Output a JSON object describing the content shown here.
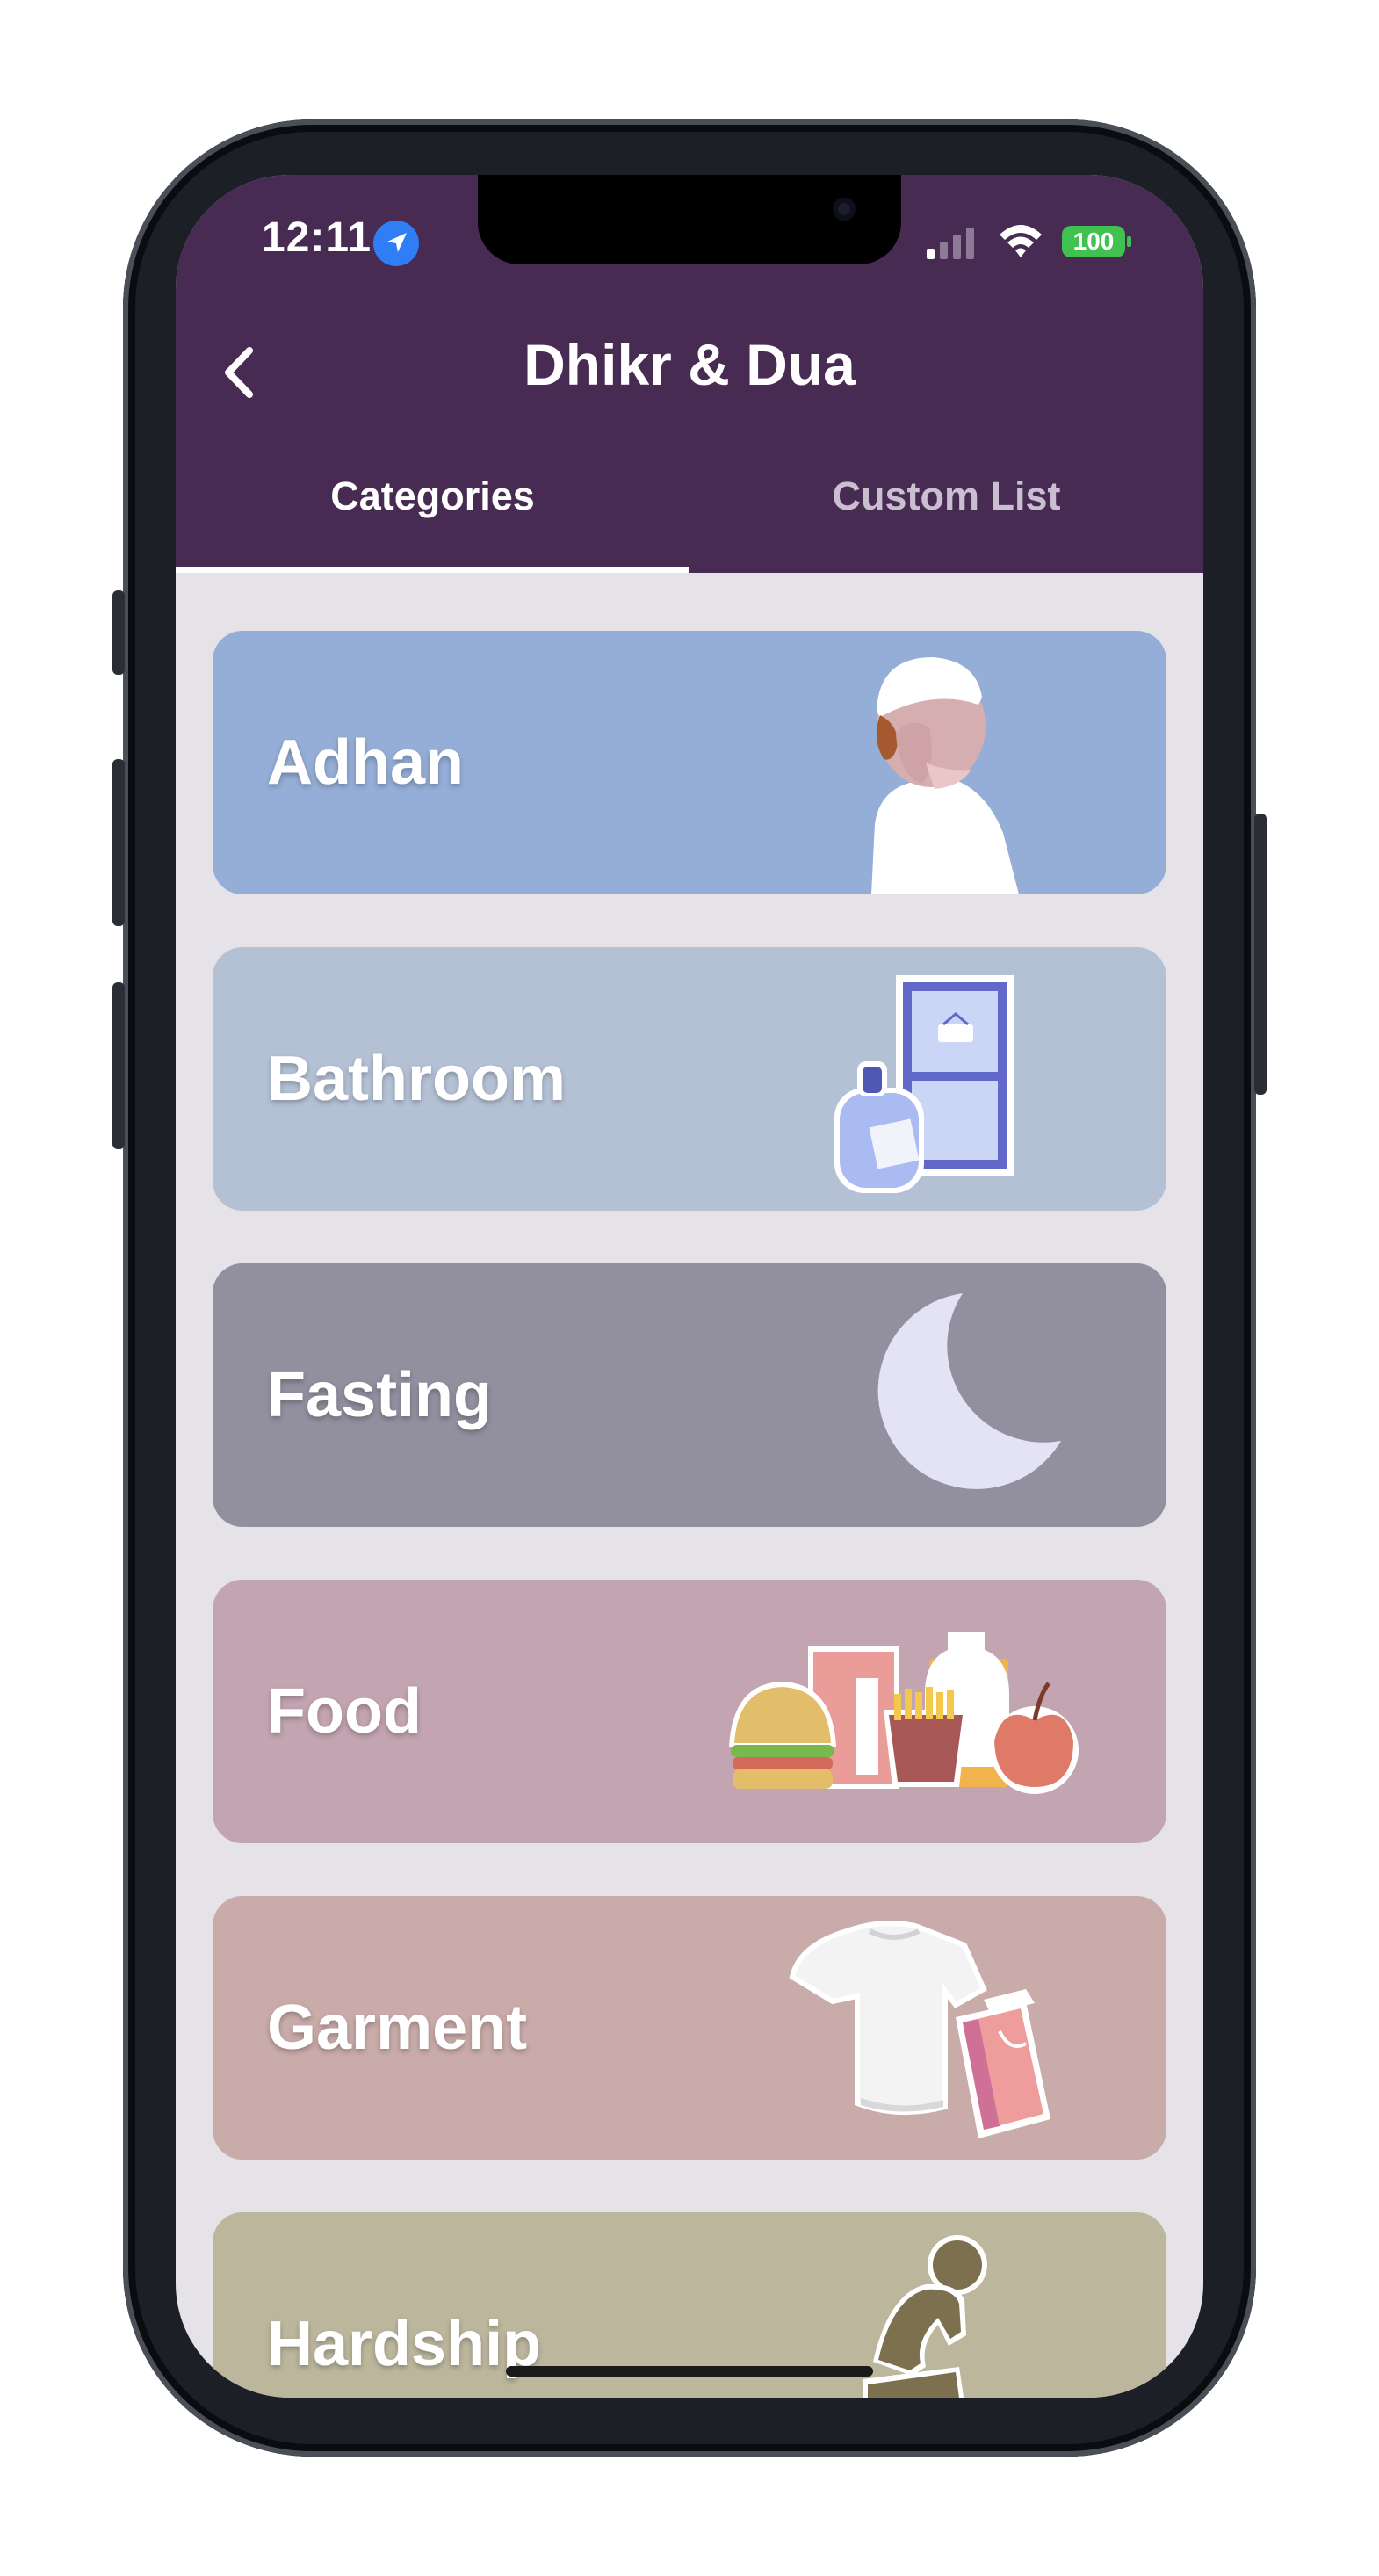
{
  "status_bar": {
    "time": "12:11",
    "battery": "100"
  },
  "header": {
    "title": "Dhikr & Dua"
  },
  "tabs": [
    {
      "label": "Categories",
      "selected": true
    },
    {
      "label": "Custom List",
      "selected": false
    }
  ],
  "categories": [
    {
      "label": "Adhan",
      "color": "#95aed7",
      "icon": "praying-man-icon"
    },
    {
      "label": "Bathroom",
      "color": "#b4c1d5",
      "icon": "door-soap-icon"
    },
    {
      "label": "Fasting",
      "color": "#928f9f",
      "icon": "crescent-moon-icon"
    },
    {
      "label": "Food",
      "color": "#c3a4b1",
      "icon": "food-icon"
    },
    {
      "label": "Garment",
      "color": "#c9aba9",
      "icon": "shirt-bag-icon"
    },
    {
      "label": "Hardship",
      "color": "#bcb69d",
      "icon": "distressed-person-icon"
    }
  ],
  "colors": {
    "header": "#472b52",
    "background": "#e5e2e8",
    "battery": "#3fc24f"
  }
}
